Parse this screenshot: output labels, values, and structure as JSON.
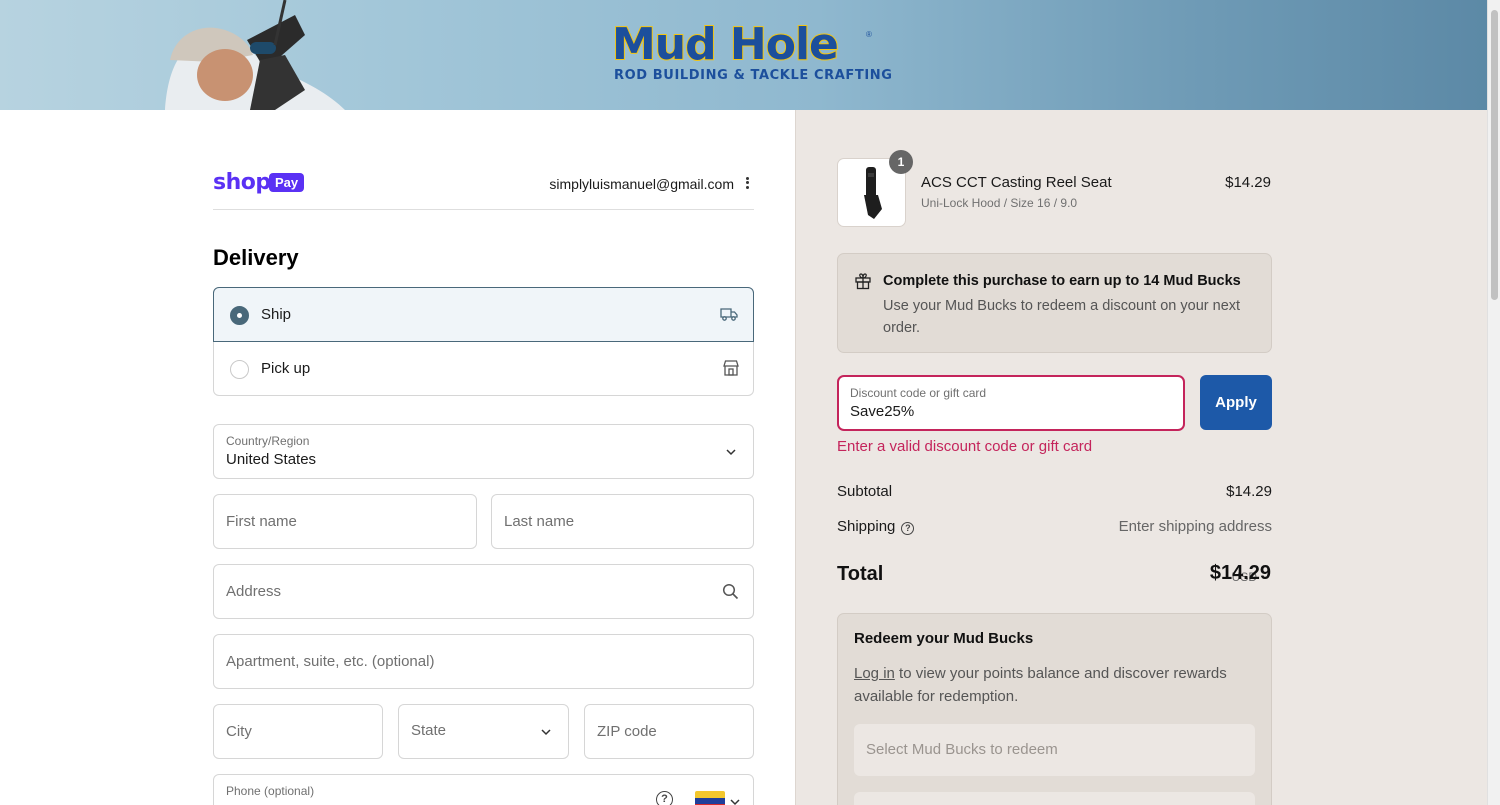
{
  "header": {
    "logo_main": "Mud Hole",
    "logo_sub": "ROD BUILDING & TACKLE CRAFTING"
  },
  "account": {
    "shop_logo": "shop",
    "pay_badge": "Pay",
    "email": "simplyluismanuel@gmail.com"
  },
  "delivery": {
    "title": "Delivery",
    "options": [
      {
        "label": "Ship",
        "selected": true,
        "icon": "truck-icon"
      },
      {
        "label": "Pick up",
        "selected": false,
        "icon": "store-icon"
      }
    ]
  },
  "form": {
    "country_label": "Country/Region",
    "country_value": "United States",
    "first_name_placeholder": "First name",
    "last_name_placeholder": "Last name",
    "address_placeholder": "Address",
    "apartment_placeholder": "Apartment, suite, etc. (optional)",
    "city_placeholder": "City",
    "state_placeholder": "State",
    "zip_placeholder": "ZIP code",
    "phone_label": "Phone (optional)"
  },
  "summary": {
    "item": {
      "quantity": "1",
      "name": "ACS CCT Casting Reel Seat",
      "variant": "Uni-Lock Hood / Size 16 / 9.0",
      "price": "$14.29"
    },
    "earn": {
      "title": "Complete this purchase to earn up to 14 Mud Bucks",
      "text": "Use your Mud Bucks to redeem a discount on your next order."
    },
    "discount": {
      "label": "Discount code or gift card",
      "value": "Save25%",
      "apply_label": "Apply",
      "error": "Enter a valid discount code or gift card"
    },
    "subtotal_label": "Subtotal",
    "subtotal_value": "$14.29",
    "shipping_label": "Shipping",
    "shipping_value": "Enter shipping address",
    "total_label": "Total",
    "total_currency": "USD",
    "total_value": "$14.29",
    "redeem": {
      "title": "Redeem your Mud Bucks",
      "login_link": "Log in",
      "text": " to view your points balance and discover rewards available for redemption.",
      "select_placeholder": "Select Mud Bucks to redeem"
    }
  },
  "colors": {
    "accent": "#1d59a8",
    "shop_purple": "#5a31f4",
    "error": "#c4245b",
    "selected_option": "#49687a"
  }
}
